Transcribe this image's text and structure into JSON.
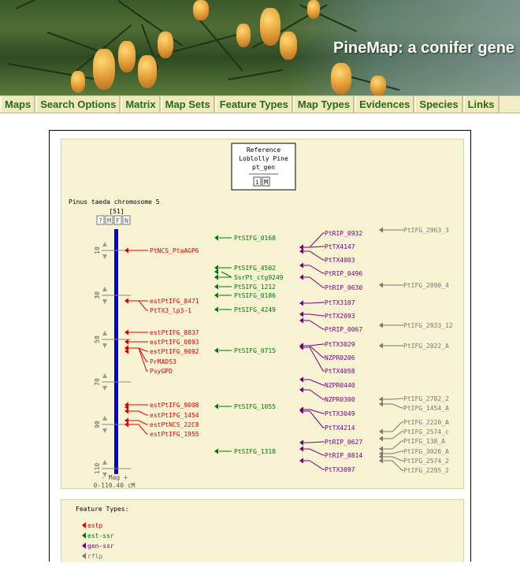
{
  "banner": {
    "title": "PineMap: a conifer gene"
  },
  "nav": {
    "items": [
      "Maps",
      "Search Options",
      "Matrix",
      "Map Sets",
      "Feature Types",
      "Map Types",
      "Evidences",
      "Species",
      "Links"
    ]
  },
  "reference_box": {
    "line1": "Reference",
    "line2": "Loblolly Pine",
    "line3": "pt_gen",
    "buttons": [
      "i",
      "M"
    ]
  },
  "map": {
    "chromosome_title": "Pinus taeda chromosome 5",
    "feature_count": "[51]",
    "control_buttons": [
      "?",
      "M",
      "F",
      "N"
    ],
    "scale_ticks": [
      "10",
      "30",
      "50",
      "70",
      "90",
      "110"
    ],
    "mag_label": "- Mag +",
    "range_label": "0-110.40 cM"
  },
  "colors": {
    "estp": "#e00000",
    "est_ssr": "#007700",
    "gen_ssr": "#770077",
    "rflp": "#777777",
    "chromosome": "#0000dd"
  },
  "features": {
    "estp": [
      "PtNCS_PtaAGP6",
      "estPtIFG_8471",
      "PtTX3_lp3-1",
      "estPtIFG_8837",
      "estPtIFG_0893",
      "estPtIFG_9092",
      "PrMADS3",
      "PsyGPD",
      "estPtIFG_9008",
      "estPtIFG_1454",
      "estPtNCS_22C8",
      "estPtIFG_1955"
    ],
    "est_ssr": [
      "PtSIFG_0168",
      "PtSIFG_4502",
      "SsrPt_ctg9249",
      "PtSIFG_1212",
      "PtSIFG_0186",
      "PtSIFG_4249",
      "PtSIFG_0715",
      "PtSIFG_1055",
      "PtSIFG_1318"
    ],
    "gen_ssr": [
      "PtRIP_0932",
      "PtTX4147",
      "PtTX4003",
      "PtRIP_0496",
      "PtRIP_0630",
      "PtTX3107",
      "PtTX2093",
      "PtRIP_0067",
      "PtTX3029",
      "NZPR0206",
      "PtTX4058",
      "NZPR0440",
      "NZPR0300",
      "PtTX3049",
      "PtTX4214",
      "PtRIP_0627",
      "PtRIP_0814",
      "PtTX3097"
    ],
    "rflp": [
      "PtIFG_2963_3",
      "PtIFG_2090_4",
      "PtIFG_2933_12",
      "PtIFG_2022_A",
      "PtIFG_2782_2",
      "PtIFG_1454_A",
      "PtIFG_2220_A",
      "PtIFG_2574_c",
      "PtIFG_138_A",
      "PtIFG_3026_A",
      "PtIFG_2574_2",
      "PtIFG_2295_2"
    ]
  },
  "legend": {
    "title": "Feature Types:",
    "entries": [
      "estp",
      "est-ssr",
      "gen-ssr",
      "rflp"
    ]
  }
}
